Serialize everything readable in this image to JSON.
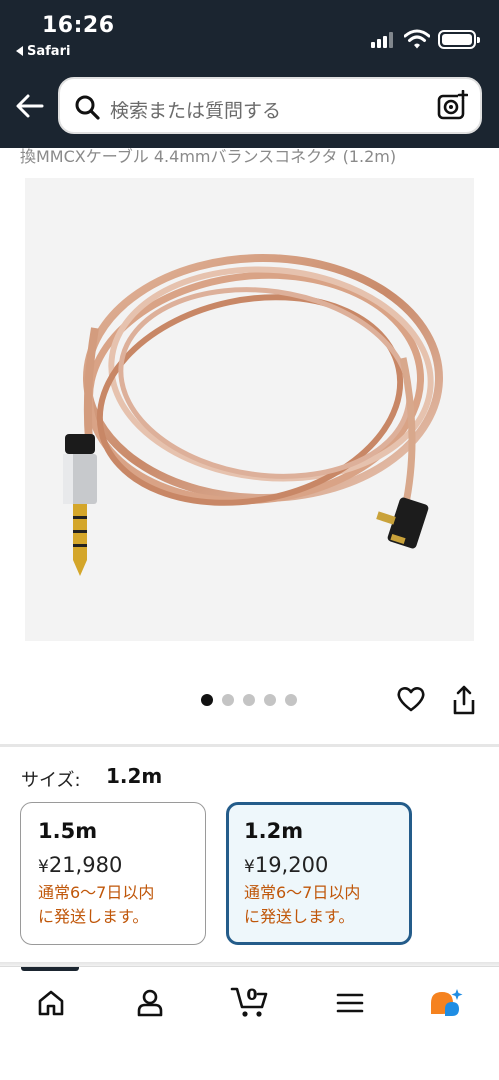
{
  "status_bar": {
    "time": "16:26",
    "back_app": "Safari"
  },
  "search": {
    "placeholder": "検索または質問する"
  },
  "product": {
    "title_fragment": "換MMCXケーブル 4.4mmバランスコネクタ (1.2m)",
    "image_count": 5,
    "active_image_index": 0
  },
  "size": {
    "label": "サイズ:",
    "selected": "1.2m",
    "options": [
      {
        "name": "1.5m",
        "currency": "¥",
        "price": "21,980",
        "shipping_line1": "通常6～7日以内",
        "shipping_line2": "に発送します。"
      },
      {
        "name": "1.2m",
        "currency": "¥",
        "price": "19,200",
        "shipping_line1": "通常6～7日以内",
        "shipping_line2": "に発送します。"
      }
    ]
  },
  "cart": {
    "count": "0"
  },
  "icons": {
    "back": "back-arrow-icon",
    "search": "search-icon",
    "camera": "camera-search-icon",
    "favorite": "heart-icon",
    "share": "share-icon",
    "nav": [
      "home-icon",
      "account-icon",
      "cart-icon",
      "menu-icon",
      "rufus-ai-icon"
    ]
  },
  "colors": {
    "header_bg": "#1b2530",
    "shipping_text": "#c0570a",
    "selected_border": "#245c8a",
    "selected_bg": "#eef7fb"
  }
}
